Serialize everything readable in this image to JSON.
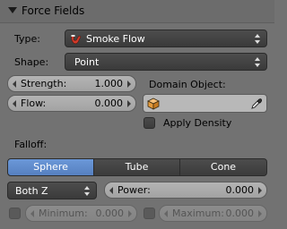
{
  "panel": {
    "title": "Force Fields"
  },
  "type": {
    "label": "Type:",
    "value": "Smoke Flow"
  },
  "shape": {
    "label": "Shape:",
    "value": "Point"
  },
  "strength": {
    "label": "Strength:",
    "value": "1.000"
  },
  "flow": {
    "label": "Flow:",
    "value": "0.000"
  },
  "domain_object": {
    "label": "Domain Object:",
    "value": ""
  },
  "apply_density": {
    "label": "Apply Density",
    "checked": false
  },
  "falloff": {
    "label": "Falloff:",
    "tabs": [
      "Sphere",
      "Tube",
      "Cone"
    ],
    "active_tab": "Sphere",
    "direction": "Both Z",
    "power": {
      "label": "Power:",
      "value": "0.000"
    },
    "minimum": {
      "label": "Minimum:",
      "value": "0.000",
      "enabled": false
    },
    "maximum": {
      "label": "Maximum:",
      "value": "0.000",
      "enabled": false
    }
  },
  "icons": [
    "disclosure-triangle-icon",
    "smoke-pipe-icon",
    "object-cube-icon",
    "eyedropper-icon"
  ],
  "colors": {
    "panel_bg": "#727272",
    "active_tab": "#5e8cd0"
  }
}
